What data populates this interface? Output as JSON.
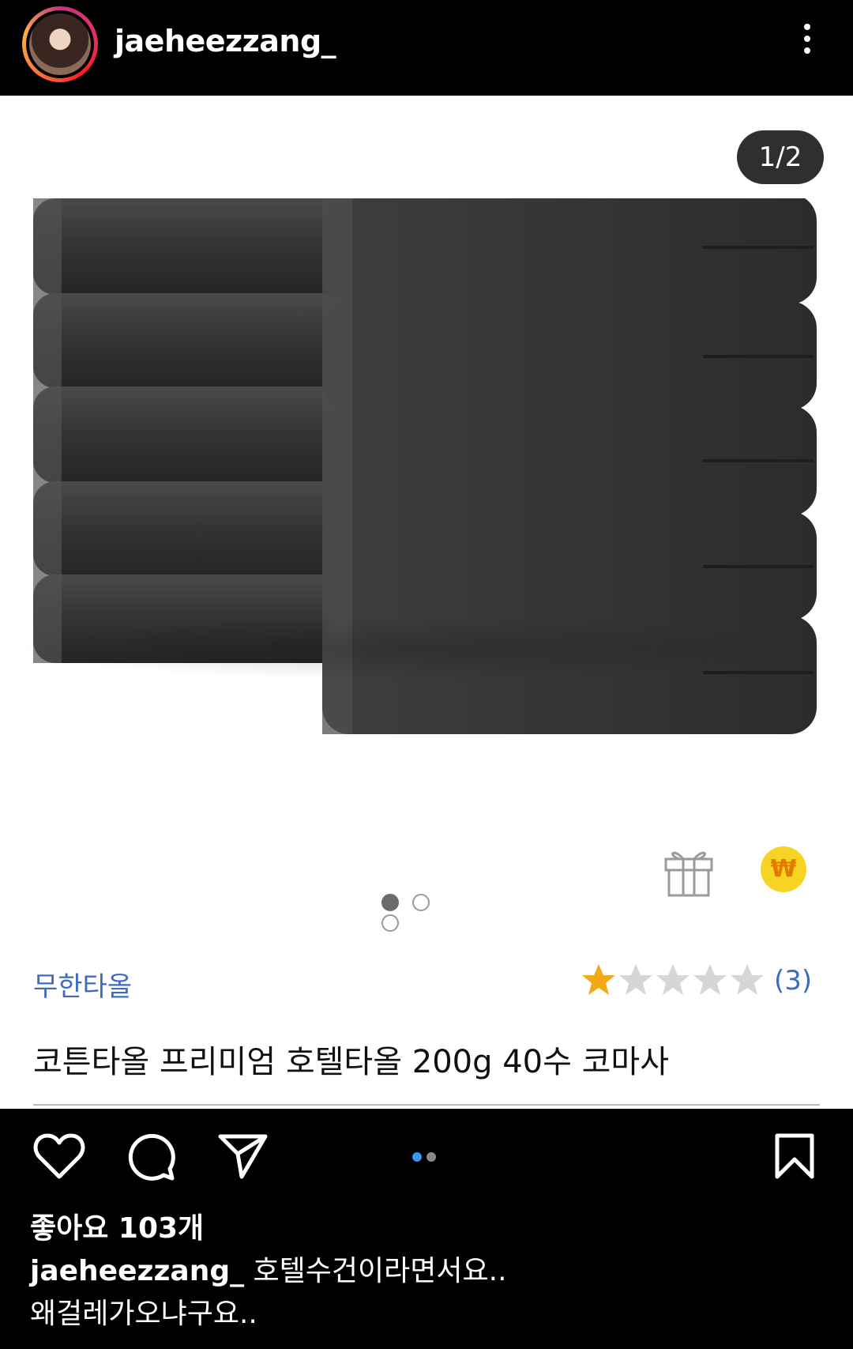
{
  "header": {
    "username": "jaeheezzang_",
    "avatar_icon": "profile-avatar",
    "more_icon": "more-vertical-icon"
  },
  "media": {
    "counter": "1/2",
    "image_description_icon": "towel-stack-photo",
    "gift_icon": "gift-icon",
    "won_icon_label": "₩",
    "image_dots_total": 3,
    "image_dots_active": 1
  },
  "product": {
    "store": "무한타올",
    "rating": 1,
    "rating_max": 5,
    "rating_count": "(3)",
    "title": "코튼타올 프리미엄 호텔타올 200g 40수 코마사"
  },
  "actions": {
    "like_icon": "heart-icon",
    "comment_icon": "comment-icon",
    "share_icon": "paper-plane-icon",
    "bookmark_icon": "bookmark-icon",
    "carousel_total": 2,
    "carousel_active": 1
  },
  "post": {
    "likes": "좋아요 103개",
    "caption_user": "jaeheezzang_",
    "caption_line1": " 호텔수건이라면서요..",
    "caption_line2": "왜걸레가오냐구요.."
  },
  "colors": {
    "link_blue": "#3d6cc1",
    "star_gold": "#f2a916",
    "star_gray": "#d6d6d6",
    "won_yellow": "#f7d423",
    "accent_blue": "#3797f0"
  }
}
